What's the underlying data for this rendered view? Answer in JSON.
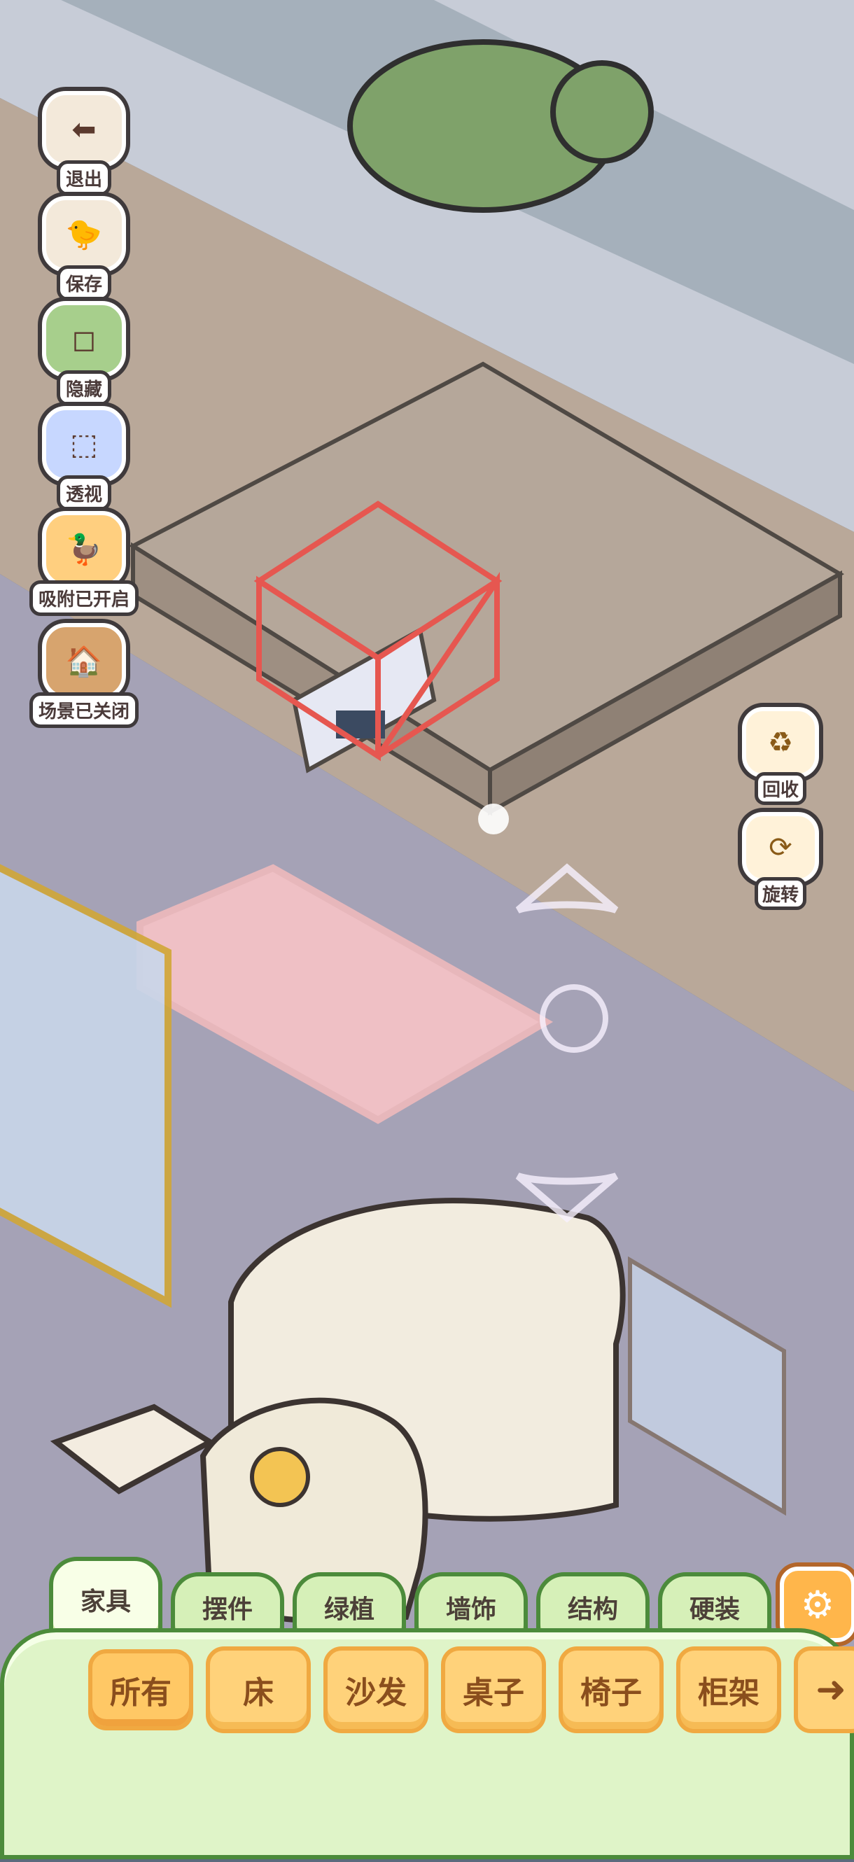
{
  "left_toolbar": [
    {
      "label": "退出",
      "icon": "exit-arrow-icon"
    },
    {
      "label": "保存",
      "icon": "save-duck-icon"
    },
    {
      "label": "隐藏",
      "icon": "hide-frame-icon"
    },
    {
      "label": "透视",
      "icon": "perspective-cube-icon"
    },
    {
      "label": "吸附已开启",
      "icon": "snap-duck-icon"
    },
    {
      "label": "场景已关闭",
      "icon": "scene-house-icon"
    }
  ],
  "right_toolbar": [
    {
      "label": "回收",
      "icon": "recycle-icon"
    },
    {
      "label": "旋转",
      "icon": "rotate-hand-icon"
    }
  ],
  "tabs": [
    {
      "label": "家具",
      "active": true
    },
    {
      "label": "摆件",
      "active": false
    },
    {
      "label": "绿植",
      "active": false
    },
    {
      "label": "墙饰",
      "active": false
    },
    {
      "label": "结构",
      "active": false
    },
    {
      "label": "硬装",
      "active": false
    }
  ],
  "settings_icon": "gear-icon",
  "categories": [
    {
      "label": "所有",
      "selected": true
    },
    {
      "label": "床",
      "selected": false
    },
    {
      "label": "沙发",
      "selected": false
    },
    {
      "label": "桌子",
      "selected": false
    },
    {
      "label": "椅子",
      "selected": false
    },
    {
      "label": "柜架",
      "selected": false
    }
  ],
  "next_icon": "arrow-right-icon",
  "colors": {
    "dock_green": "#dff4c8",
    "tab_border": "#4c8b3b",
    "category_yellow": "#ffd27a",
    "outline": "#3f3a3c"
  }
}
